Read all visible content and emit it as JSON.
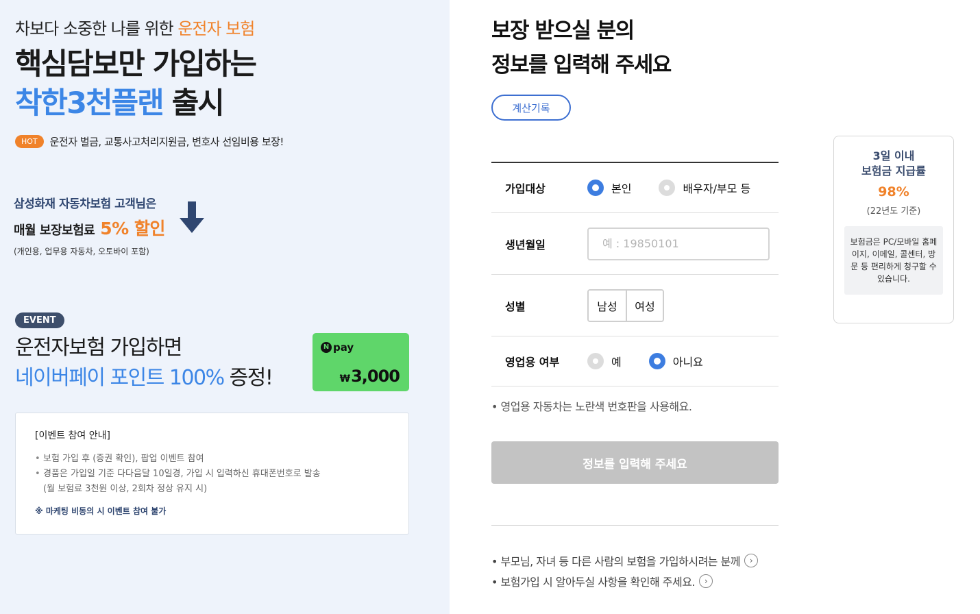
{
  "promo": {
    "subtitle_prefix": "차보다 소중한 나를 위한 ",
    "subtitle_accent": "운전자 보험",
    "title_line1": "핵심담보만 가입하는",
    "title_blue": "착한3천플랜",
    "title_rest": " 출시",
    "hot_badge": "HOT",
    "hot_text": "운전자 벌금, 교통사고처리지원금, 변호사 선임비용 보장!",
    "samsung_line1": "삼성화재 자동차보험 고객님은",
    "samsung_line2": "매월 보장보험료",
    "samsung_discount": "5% 할인",
    "samsung_note": "(개인용, 업무용 자동차, 오토바이 포함)",
    "event_badge": "EVENT",
    "event_line1": "운전자보험 가입하면",
    "event_blue": "네이버페이 포인트 100%",
    "event_rest": " 증정!",
    "npay_logo": "pay",
    "npay_n": "N",
    "npay_currency": "₩",
    "npay_amount": "3,000",
    "box_title": "[이벤트 참여 안내]",
    "box_item1": "보험 가입 후 (증권 확인), 팝업 이벤트 참여",
    "box_item2": "경품은 가입일 기준 다다음달 10일경, 가입 시 입력하신 휴대폰번호로 발송",
    "box_item2_sub": "(월 보험료 3천원 이상, 2회차 정상 유지 시)",
    "box_notice": "※ 마케팅 비동의 시 이벤트 참여 불가"
  },
  "form": {
    "title_line1": "보장 받으실 분의",
    "title_line2": "정보를 입력해 주세요",
    "history_button": "계산기록",
    "target_label": "가입대상",
    "target_self": "본인",
    "target_family": "배우자/부모 등",
    "birth_label": "생년월일",
    "birth_placeholder": "예 : 19850101",
    "gender_label": "성별",
    "gender_male": "남성",
    "gender_female": "여성",
    "business_label": "영업용 여부",
    "business_yes": "예",
    "business_no": "아니요",
    "hint": "• 영업용 자동차는 노란색 번호판을 사용해요.",
    "submit": "정보를 입력해 주세요",
    "link1": "• 부모님, 자녀 등 다른 사람의 보험을 가입하시려는 분께",
    "link2": "• 보험가입 시 알아두실 사항을 확인해 주세요."
  },
  "side_card": {
    "title_line1": "3일 이내",
    "title_line2": "보험금 지급률",
    "rate": "98%",
    "basis": "(22년도 기준)",
    "note": "보험금은 PC/모바일 홈페이지, 이메일, 콜센터, 방문 등 편리하게 청구할 수 있습니다."
  },
  "colors": {
    "accent_orange": "#f0822a",
    "accent_blue": "#3c86e6",
    "primary_blue": "#3d6fd1",
    "npay_green": "#5fd66a"
  }
}
